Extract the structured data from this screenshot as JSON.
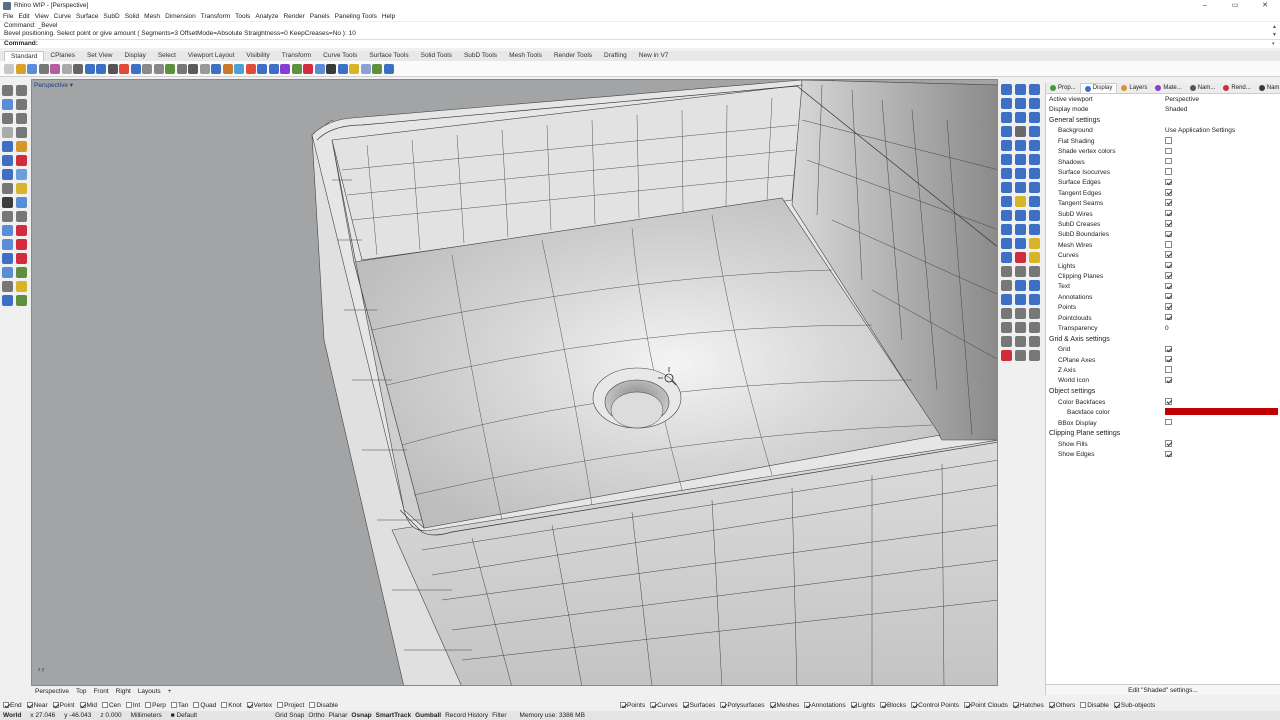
{
  "window": {
    "title": "Rhino WIP - [Perspective]",
    "minimize": "–",
    "maximize": "▭",
    "close": "✕"
  },
  "menu": [
    "File",
    "Edit",
    "View",
    "Curve",
    "Surface",
    "SubD",
    "Solid",
    "Mesh",
    "Dimension",
    "Transform",
    "Tools",
    "Analyze",
    "Render",
    "Panels",
    "Paneling Tools",
    "Help"
  ],
  "command_history": [
    "Command: _Bevel",
    "Bevel positioning. Select point or give amount ( Segments=3  OffsetMode=Absolute  Straightness=0  KeepCreases=No ): 10"
  ],
  "command_prompt": "Command:",
  "toolbar_tabs": [
    "Standard",
    "CPlanes",
    "Set View",
    "Display",
    "Select",
    "Viewport Layout",
    "Visibility",
    "Transform",
    "Curve Tools",
    "Surface Tools",
    "Solid Tools",
    "SubD Tools",
    "Mesh Tools",
    "Render Tools",
    "Drafting",
    "New in V7"
  ],
  "toolbar_colors": [
    "#c8c8c8",
    "#d9a12a",
    "#5a8dd6",
    "#777",
    "#b55d9e",
    "#aaa",
    "#666",
    "#3d6fc4",
    "#3d6fc4",
    "#555",
    "#e04b3a",
    "#3d6fc4",
    "#8a8a8a",
    "#888",
    "#5e8f3c",
    "#777",
    "#5a5a5a",
    "#999",
    "#3d6fc4",
    "#c87a2a",
    "#4aa0d8",
    "#e04b3a",
    "#3d6fc4",
    "#3d6fc4",
    "#8a3ad6",
    "#5e8f3c",
    "#d02c3c",
    "#5a8dd6",
    "#3a3a3a",
    "#3d6fc4",
    "#d6b52a",
    "#8aa0d6",
    "#5e8f3c",
    "#3d6fc4"
  ],
  "left_tool_colors": [
    "#777",
    "#777",
    "#5a8dd6",
    "#777",
    "#777",
    "#777",
    "#aaa",
    "#777",
    "#3d6fc4",
    "#d6972a",
    "#3d6fc4",
    "#d02c3c",
    "#3d6fc4",
    "#6aa0d6",
    "#777",
    "#d6b52a",
    "#3d3d3d",
    "#5a8dd6",
    "#777",
    "#777",
    "#5a8dd6",
    "#d02c3c",
    "#5a8dd6",
    "#d02c3c",
    "#3d6fc4",
    "#d02c3c",
    "#5a8dd6",
    "#5e8f3c",
    "#777",
    "#d6b52a",
    "#3d6fc4",
    "#5e8f3c"
  ],
  "right_tool_colors": [
    "#3d6fc4",
    "#3d6fc4",
    "#3d6fc4",
    "#3d6fc4",
    "#3d6fc4",
    "#3d6fc4",
    "#3d6fc4",
    "#3d6fc4",
    "#3d6fc4",
    "#3d6fc4",
    "#6a6a6a",
    "#3d6fc4",
    "#3d6fc4",
    "#3d6fc4",
    "#3d6fc4",
    "#3d6fc4",
    "#3d6fc4",
    "#3d6fc4",
    "#3d6fc4",
    "#3d6fc4",
    "#3d6fc4",
    "#3d6fc4",
    "#3d6fc4",
    "#3d6fc4",
    "#3d6fc4",
    "#d6b52a",
    "#3d6fc4",
    "#3d6fc4",
    "#3d6fc4",
    "#3d6fc4",
    "#3d6fc4",
    "#3d6fc4",
    "#3d6fc4",
    "#3d6fc4",
    "#3d6fc4",
    "#d6b52a",
    "#3d6fc4",
    "#d02c3c",
    "#d6b52a",
    "#777",
    "#777",
    "#777",
    "#777",
    "#3d6fc4",
    "#3d6fc4",
    "#3d6fc4",
    "#3d6fc4",
    "#3d6fc4",
    "#777",
    "#777",
    "#777",
    "#777",
    "#777",
    "#777",
    "#777",
    "#777",
    "#777",
    "#d02c3c",
    "#777",
    "#777"
  ],
  "viewport": {
    "label": "Perspective",
    "menu_arrow": "▾",
    "axis": "z\ny"
  },
  "panel_tabs": [
    {
      "label": "Prop...",
      "color": "#3d9c3d"
    },
    {
      "label": "Display",
      "color": "#3d6fc4"
    },
    {
      "label": "Layers",
      "color": "#d6972a"
    },
    {
      "label": "Mate...",
      "color": "#8a3ad6"
    },
    {
      "label": "Nam...",
      "color": "#555"
    },
    {
      "label": "Rend...",
      "color": "#d02c3c"
    },
    {
      "label": "Nam...",
      "color": "#3a3a3a"
    }
  ],
  "display_panel": {
    "active_viewport_label": "Active viewport",
    "active_viewport_value": "Perspective",
    "display_mode_label": "Display mode",
    "display_mode_value": "Shaded",
    "general_heading": "General settings",
    "background_label": "Background",
    "background_value": "Use Application Settings",
    "general_rows": [
      {
        "label": "Flat Shading",
        "checked": false
      },
      {
        "label": "Shade vertex colors",
        "checked": false
      },
      {
        "label": "Shadows",
        "checked": false
      },
      {
        "label": "Surface Isocurves",
        "checked": false
      },
      {
        "label": "Surface Edges",
        "checked": true
      },
      {
        "label": "Tangent Edges",
        "checked": true
      },
      {
        "label": "Tangent Seams",
        "checked": true
      },
      {
        "label": "SubD Wires",
        "checked": true
      },
      {
        "label": "SubD Creases",
        "checked": true
      },
      {
        "label": "SubD Boundaries",
        "checked": true
      },
      {
        "label": "Mesh Wires",
        "checked": false
      },
      {
        "label": "Curves",
        "checked": true
      },
      {
        "label": "Lights",
        "checked": true
      },
      {
        "label": "Clipping Planes",
        "checked": true
      },
      {
        "label": "Text",
        "checked": true
      },
      {
        "label": "Annotations",
        "checked": true
      },
      {
        "label": "Points",
        "checked": true
      },
      {
        "label": "Pointclouds",
        "checked": true
      }
    ],
    "transparency_label": "Transparency",
    "transparency_value": "0",
    "grid_heading": "Grid & Axis settings",
    "grid_rows": [
      {
        "label": "Grid",
        "checked": true
      },
      {
        "label": "CPlane Axes",
        "checked": true
      },
      {
        "label": "Z Axis",
        "checked": false
      },
      {
        "label": "World Icon",
        "checked": true
      }
    ],
    "object_heading": "Object settings",
    "color_backfaces_label": "Color Backfaces",
    "color_backfaces_checked": true,
    "backface_color_label": "Backface color",
    "backface_color": "#c00000",
    "bbox_label": "BBox Display",
    "bbox_checked": false,
    "clip_heading": "Clipping Plane settings",
    "clip_rows": [
      {
        "label": "Show Fills",
        "checked": true
      },
      {
        "label": "Show Edges",
        "checked": true
      }
    ],
    "footer": "Edit \"Shaded\" settings..."
  },
  "viewport_tabs": [
    "Perspective",
    "Top",
    "Front",
    "Right",
    "Layouts",
    "+"
  ],
  "osnaps": [
    {
      "label": "End",
      "checked": true
    },
    {
      "label": "Near",
      "checked": true
    },
    {
      "label": "Point",
      "checked": true
    },
    {
      "label": "Mid",
      "checked": true
    },
    {
      "label": "Cen",
      "checked": false
    },
    {
      "label": "Int",
      "checked": false
    },
    {
      "label": "Perp",
      "checked": false
    },
    {
      "label": "Tan",
      "checked": false
    },
    {
      "label": "Quad",
      "checked": false
    },
    {
      "label": "Knot",
      "checked": false
    },
    {
      "label": "Vertex",
      "checked": true
    },
    {
      "label": "Project",
      "checked": false
    },
    {
      "label": "Disable",
      "checked": false
    }
  ],
  "selection_filters": [
    {
      "label": "Points",
      "checked": true
    },
    {
      "label": "Curves",
      "checked": true
    },
    {
      "label": "Surfaces",
      "checked": true
    },
    {
      "label": "Polysurfaces",
      "checked": true
    },
    {
      "label": "Meshes",
      "checked": true
    },
    {
      "label": "Annotations",
      "checked": true
    },
    {
      "label": "Lights",
      "checked": true
    },
    {
      "label": "Blocks",
      "checked": true
    },
    {
      "label": "Control Points",
      "checked": true
    },
    {
      "label": "Point Clouds",
      "checked": true
    },
    {
      "label": "Hatches",
      "checked": true
    },
    {
      "label": "Others",
      "checked": true
    },
    {
      "label": "Disable",
      "checked": false
    },
    {
      "label": "Sub-objects",
      "checked": true
    }
  ],
  "status": {
    "cplane": "World",
    "x": "x 27.046",
    "y": "y -46.043",
    "z": "z 0.000",
    "units": "Millimeters",
    "layer": "Default",
    "toggles": [
      "Grid Snap",
      "Ortho",
      "Planar",
      "Osnap",
      "SmartTrack",
      "Gumball",
      "Record History",
      "Filter"
    ],
    "bold_toggles": [
      "Osnap",
      "SmartTrack",
      "Gumball"
    ],
    "memory": "Memory use: 3386 MB"
  }
}
